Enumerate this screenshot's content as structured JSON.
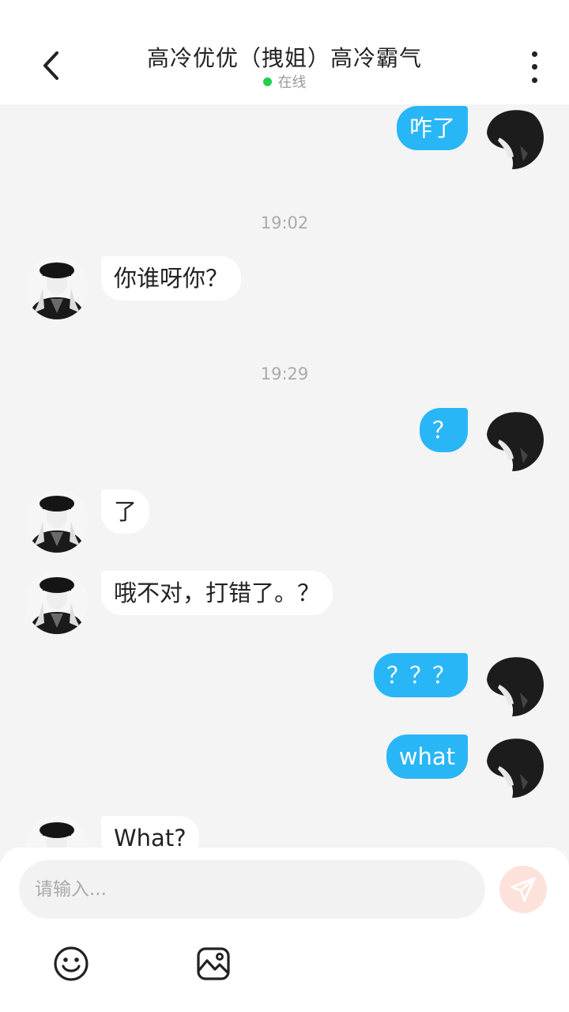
{
  "header": {
    "title": "高冷优优（拽姐）高冷霸气",
    "status": "在线",
    "status_color": "#22d04b"
  },
  "messages": [
    {
      "side": "right",
      "text": "咋了"
    },
    {
      "type": "time",
      "text": "19:02"
    },
    {
      "side": "left",
      "text": "你谁呀你？"
    },
    {
      "type": "time",
      "text": "19:29"
    },
    {
      "side": "right",
      "text": "？"
    },
    {
      "side": "left",
      "text": "了"
    },
    {
      "side": "left",
      "text": "哦不对，打错了。？"
    },
    {
      "side": "right",
      "text": "？？？"
    },
    {
      "side": "right",
      "text": "what"
    },
    {
      "side": "left",
      "text": "What?"
    }
  ],
  "input": {
    "placeholder": "请输入..."
  },
  "toolbar": {
    "emoji_icon": "smiley-icon",
    "image_icon": "image-icon",
    "send_icon": "paper-plane-icon"
  },
  "colors": {
    "outgoing_bubble": "#29b6f6",
    "incoming_bubble": "#ffffff",
    "background": "#f3f4f3",
    "send_button": "#fde2dc"
  }
}
